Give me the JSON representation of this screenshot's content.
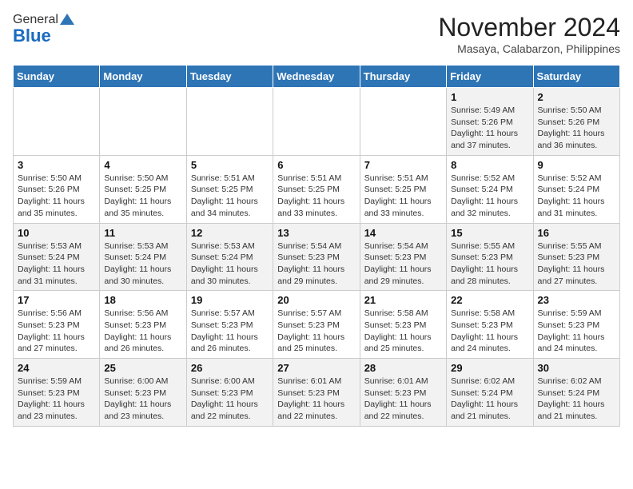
{
  "logo": {
    "general": "General",
    "blue": "Blue"
  },
  "header": {
    "month": "November 2024",
    "location": "Masaya, Calabarzon, Philippines"
  },
  "weekdays": [
    "Sunday",
    "Monday",
    "Tuesday",
    "Wednesday",
    "Thursday",
    "Friday",
    "Saturday"
  ],
  "weeks": [
    [
      {
        "day": "",
        "info": ""
      },
      {
        "day": "",
        "info": ""
      },
      {
        "day": "",
        "info": ""
      },
      {
        "day": "",
        "info": ""
      },
      {
        "day": "",
        "info": ""
      },
      {
        "day": "1",
        "info": "Sunrise: 5:49 AM\nSunset: 5:26 PM\nDaylight: 11 hours\nand 37 minutes."
      },
      {
        "day": "2",
        "info": "Sunrise: 5:50 AM\nSunset: 5:26 PM\nDaylight: 11 hours\nand 36 minutes."
      }
    ],
    [
      {
        "day": "3",
        "info": "Sunrise: 5:50 AM\nSunset: 5:26 PM\nDaylight: 11 hours\nand 35 minutes."
      },
      {
        "day": "4",
        "info": "Sunrise: 5:50 AM\nSunset: 5:25 PM\nDaylight: 11 hours\nand 35 minutes."
      },
      {
        "day": "5",
        "info": "Sunrise: 5:51 AM\nSunset: 5:25 PM\nDaylight: 11 hours\nand 34 minutes."
      },
      {
        "day": "6",
        "info": "Sunrise: 5:51 AM\nSunset: 5:25 PM\nDaylight: 11 hours\nand 33 minutes."
      },
      {
        "day": "7",
        "info": "Sunrise: 5:51 AM\nSunset: 5:25 PM\nDaylight: 11 hours\nand 33 minutes."
      },
      {
        "day": "8",
        "info": "Sunrise: 5:52 AM\nSunset: 5:24 PM\nDaylight: 11 hours\nand 32 minutes."
      },
      {
        "day": "9",
        "info": "Sunrise: 5:52 AM\nSunset: 5:24 PM\nDaylight: 11 hours\nand 31 minutes."
      }
    ],
    [
      {
        "day": "10",
        "info": "Sunrise: 5:53 AM\nSunset: 5:24 PM\nDaylight: 11 hours\nand 31 minutes."
      },
      {
        "day": "11",
        "info": "Sunrise: 5:53 AM\nSunset: 5:24 PM\nDaylight: 11 hours\nand 30 minutes."
      },
      {
        "day": "12",
        "info": "Sunrise: 5:53 AM\nSunset: 5:24 PM\nDaylight: 11 hours\nand 30 minutes."
      },
      {
        "day": "13",
        "info": "Sunrise: 5:54 AM\nSunset: 5:23 PM\nDaylight: 11 hours\nand 29 minutes."
      },
      {
        "day": "14",
        "info": "Sunrise: 5:54 AM\nSunset: 5:23 PM\nDaylight: 11 hours\nand 29 minutes."
      },
      {
        "day": "15",
        "info": "Sunrise: 5:55 AM\nSunset: 5:23 PM\nDaylight: 11 hours\nand 28 minutes."
      },
      {
        "day": "16",
        "info": "Sunrise: 5:55 AM\nSunset: 5:23 PM\nDaylight: 11 hours\nand 27 minutes."
      }
    ],
    [
      {
        "day": "17",
        "info": "Sunrise: 5:56 AM\nSunset: 5:23 PM\nDaylight: 11 hours\nand 27 minutes."
      },
      {
        "day": "18",
        "info": "Sunrise: 5:56 AM\nSunset: 5:23 PM\nDaylight: 11 hours\nand 26 minutes."
      },
      {
        "day": "19",
        "info": "Sunrise: 5:57 AM\nSunset: 5:23 PM\nDaylight: 11 hours\nand 26 minutes."
      },
      {
        "day": "20",
        "info": "Sunrise: 5:57 AM\nSunset: 5:23 PM\nDaylight: 11 hours\nand 25 minutes."
      },
      {
        "day": "21",
        "info": "Sunrise: 5:58 AM\nSunset: 5:23 PM\nDaylight: 11 hours\nand 25 minutes."
      },
      {
        "day": "22",
        "info": "Sunrise: 5:58 AM\nSunset: 5:23 PM\nDaylight: 11 hours\nand 24 minutes."
      },
      {
        "day": "23",
        "info": "Sunrise: 5:59 AM\nSunset: 5:23 PM\nDaylight: 11 hours\nand 24 minutes."
      }
    ],
    [
      {
        "day": "24",
        "info": "Sunrise: 5:59 AM\nSunset: 5:23 PM\nDaylight: 11 hours\nand 23 minutes."
      },
      {
        "day": "25",
        "info": "Sunrise: 6:00 AM\nSunset: 5:23 PM\nDaylight: 11 hours\nand 23 minutes."
      },
      {
        "day": "26",
        "info": "Sunrise: 6:00 AM\nSunset: 5:23 PM\nDaylight: 11 hours\nand 22 minutes."
      },
      {
        "day": "27",
        "info": "Sunrise: 6:01 AM\nSunset: 5:23 PM\nDaylight: 11 hours\nand 22 minutes."
      },
      {
        "day": "28",
        "info": "Sunrise: 6:01 AM\nSunset: 5:23 PM\nDaylight: 11 hours\nand 22 minutes."
      },
      {
        "day": "29",
        "info": "Sunrise: 6:02 AM\nSunset: 5:24 PM\nDaylight: 11 hours\nand 21 minutes."
      },
      {
        "day": "30",
        "info": "Sunrise: 6:02 AM\nSunset: 5:24 PM\nDaylight: 11 hours\nand 21 minutes."
      }
    ]
  ]
}
